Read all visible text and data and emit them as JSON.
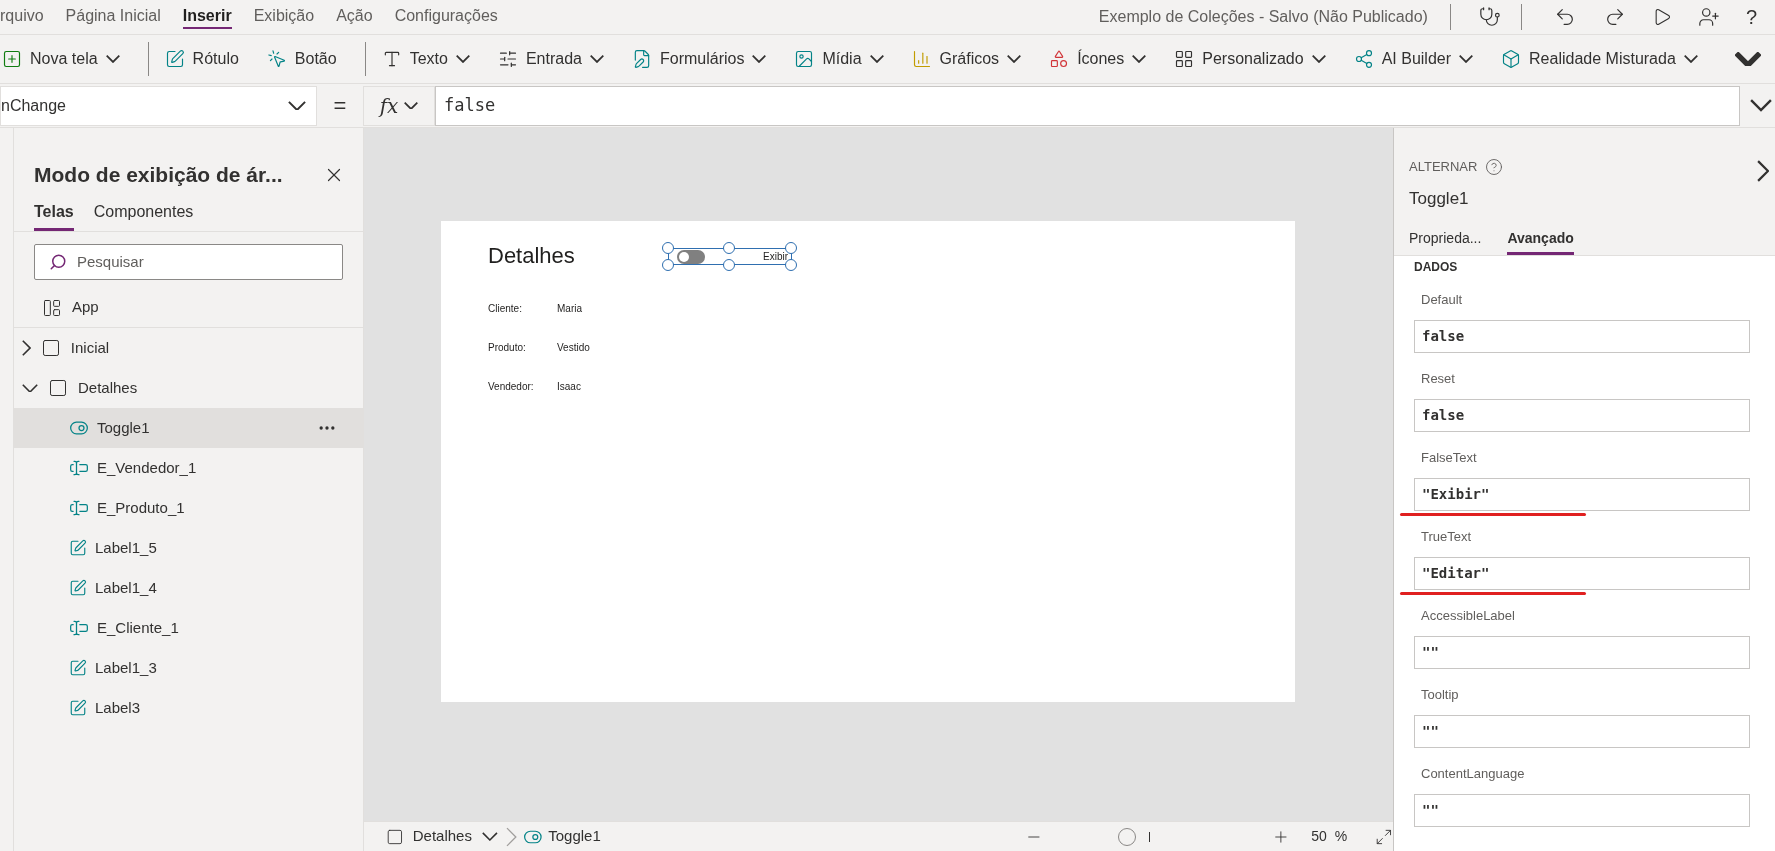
{
  "menu": {
    "items": [
      {
        "label": "rquivo",
        "selected": false
      },
      {
        "label": "Página Inicial",
        "selected": false
      },
      {
        "label": "Inserir",
        "selected": true
      },
      {
        "label": "Exibição",
        "selected": false
      },
      {
        "label": "Ação",
        "selected": false
      },
      {
        "label": "Configurações",
        "selected": false
      }
    ],
    "title": "Exemplo de Coleções - Salvo (Não Publicado)",
    "help": "?"
  },
  "toolbar": {
    "groups": [
      [
        {
          "label": "Nova tela",
          "dropdown": true
        }
      ],
      [
        {
          "label": "Rótulo",
          "dropdown": false
        },
        {
          "label": "Botão",
          "dropdown": false
        }
      ],
      [
        {
          "label": "Texto",
          "dropdown": true
        },
        {
          "label": "Entrada",
          "dropdown": true
        },
        {
          "label": "Formulários",
          "dropdown": true
        },
        {
          "label": "Mídia",
          "dropdown": true
        },
        {
          "label": "Gráficos",
          "dropdown": true
        },
        {
          "label": "Ícones",
          "dropdown": true
        },
        {
          "label": "Personalizado",
          "dropdown": true
        },
        {
          "label": "AI Builder",
          "dropdown": true
        },
        {
          "label": "Realidade Misturada",
          "dropdown": true
        }
      ]
    ]
  },
  "formula_bar": {
    "property": "nChange",
    "equals": "=",
    "fx": "fx",
    "value": "false"
  },
  "tree_panel": {
    "title": "Modo de exibição de ár...",
    "tabs": [
      {
        "label": "Telas",
        "selected": true
      },
      {
        "label": "Componentes",
        "selected": false
      }
    ],
    "search": {
      "placeholder": "Pesquisar"
    },
    "items": [
      {
        "label": "App",
        "kind": "app",
        "selected": false
      },
      {
        "label": "Inicial",
        "kind": "screen",
        "expanded": false,
        "selected": false
      },
      {
        "label": "Detalhes",
        "kind": "screen",
        "expanded": true,
        "selected": false,
        "children": [
          {
            "label": "Toggle1",
            "kind": "toggle",
            "selected": true
          },
          {
            "label": "E_Vendedor_1",
            "kind": "input",
            "selected": false
          },
          {
            "label": "E_Produto_1",
            "kind": "input",
            "selected": false
          },
          {
            "label": "Label1_5",
            "kind": "label",
            "selected": false
          },
          {
            "label": "Label1_4",
            "kind": "label",
            "selected": false
          },
          {
            "label": "E_Cliente_1",
            "kind": "input",
            "selected": false
          },
          {
            "label": "Label1_3",
            "kind": "label",
            "selected": false
          },
          {
            "label": "Label3",
            "kind": "label",
            "selected": false
          }
        ]
      }
    ]
  },
  "canvas": {
    "heading": "Detalhes",
    "toggle": {
      "on": false,
      "label": "Exibir",
      "selected": true
    },
    "rows": [
      {
        "label": "Cliente:",
        "value": "Maria"
      },
      {
        "label": "Produto:",
        "value": "Vestido"
      },
      {
        "label": "Vendedor:",
        "value": "Isaac"
      }
    ]
  },
  "bottom_bar": {
    "screen": "Detalhes",
    "control": "Toggle1",
    "zoom": {
      "level": 0.35
    },
    "zoom_value": "50",
    "zoom_unit": "%"
  },
  "properties_panel": {
    "type": "ALTERNAR",
    "name": "Toggle1",
    "tabs": [
      {
        "label": "Proprieda...",
        "selected": false
      },
      {
        "label": "Avançado",
        "selected": true
      }
    ],
    "section": "DADOS",
    "fields": [
      {
        "label": "Default",
        "value": "false",
        "underlined": false
      },
      {
        "label": "Reset",
        "value": "false",
        "underlined": false
      },
      {
        "label": "FalseText",
        "value": "\"Exibir\"",
        "underlined": true
      },
      {
        "label": "TrueText",
        "value": "\"Editar\"",
        "underlined": true
      },
      {
        "label": "AccessibleLabel",
        "value": "\"\"",
        "underlined": false
      },
      {
        "label": "Tooltip",
        "value": "\"\"",
        "underlined": false
      },
      {
        "label": "ContentLanguage",
        "value": "\"\"",
        "underlined": false
      }
    ]
  }
}
